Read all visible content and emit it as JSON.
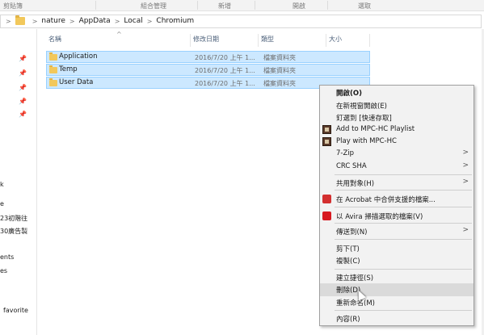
{
  "ribbon": {
    "groups": [
      "剪貼簿",
      "組合管理",
      "新增",
      "開啟",
      "選取"
    ]
  },
  "address": {
    "crumbs": [
      "nature",
      "AppData",
      "Local",
      "Chromium"
    ]
  },
  "nav": {
    "items": [
      "k",
      "e",
      "23初階往",
      "30廣告製",
      "ents",
      "es",
      "favorite"
    ]
  },
  "columns": {
    "name": "名稱",
    "date": "修改日期",
    "type": "類型",
    "size": "大小"
  },
  "files": [
    {
      "name": "Application",
      "date": "2016/7/20 上午 1...",
      "type": "檔案資料夾"
    },
    {
      "name": "Temp",
      "date": "2016/7/20 上午 1...",
      "type": "檔案資料夾"
    },
    {
      "name": "User Data",
      "date": "2016/7/20 上午 1...",
      "type": "檔案資料夾"
    }
  ],
  "menu": {
    "open": "開啟(O)",
    "open_new_window": "在新視窗開啟(E)",
    "pin_quick_access": "釘選到 [快速存取]",
    "mpc_add": "Add to MPC-HC Playlist",
    "mpc_play": "Play with MPC-HC",
    "zip": "7-Zip",
    "crc": "CRC SHA",
    "share_with": "共用對象(H)",
    "acrobat": "在 Acrobat 中合併支援的檔案...",
    "avira": "以 Avira 掃描選取的檔案(V)",
    "send_to": "傳送到(N)",
    "cut": "剪下(T)",
    "copy": "複製(C)",
    "shortcut": "建立捷徑(S)",
    "delete": "刪除(D)",
    "rename": "重新命名(M)",
    "properties": "內容(R)"
  },
  "colors": {
    "selection": "#cce8ff",
    "selection_border": "#99d1ff",
    "menu_bg": "#f2f2f2",
    "menu_highlight": "#dadada",
    "folder": "#f2c85b"
  }
}
